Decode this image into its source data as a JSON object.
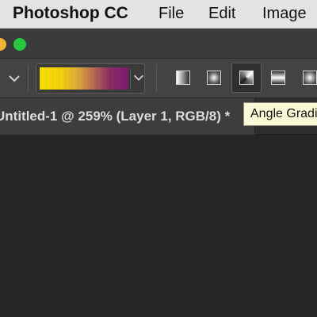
{
  "menubar": {
    "app_name": "Photoshop CC",
    "items": [
      "File",
      "Edit",
      "Image"
    ]
  },
  "window": {
    "traffic_lights": [
      {
        "name": "minimize",
        "color": "#f5b430"
      },
      {
        "name": "zoom",
        "color": "#28c840"
      }
    ]
  },
  "options_bar": {
    "gradient": {
      "colors": [
        "#f6df00",
        "#d9a23e",
        "#b56553",
        "#7b1b6d"
      ]
    },
    "gradient_types": [
      {
        "name": "linear-gradient-icon",
        "active": false
      },
      {
        "name": "radial-gradient-icon",
        "active": false
      },
      {
        "name": "angle-gradient-icon",
        "active": true
      },
      {
        "name": "reflected-gradient-icon",
        "active": false
      },
      {
        "name": "diamond-gradient-icon",
        "active": false
      }
    ]
  },
  "document": {
    "tab_title": "Untitled-1 @ 259% (Layer 1, RGB/8) *"
  },
  "tooltip": {
    "text": "Angle Gradient"
  },
  "colors": {
    "menubar_bg": "#e3e3e5",
    "panel_bg": "#434343",
    "canvas_bg": "#262626",
    "tooltip_bg": "#fcfbd7"
  }
}
